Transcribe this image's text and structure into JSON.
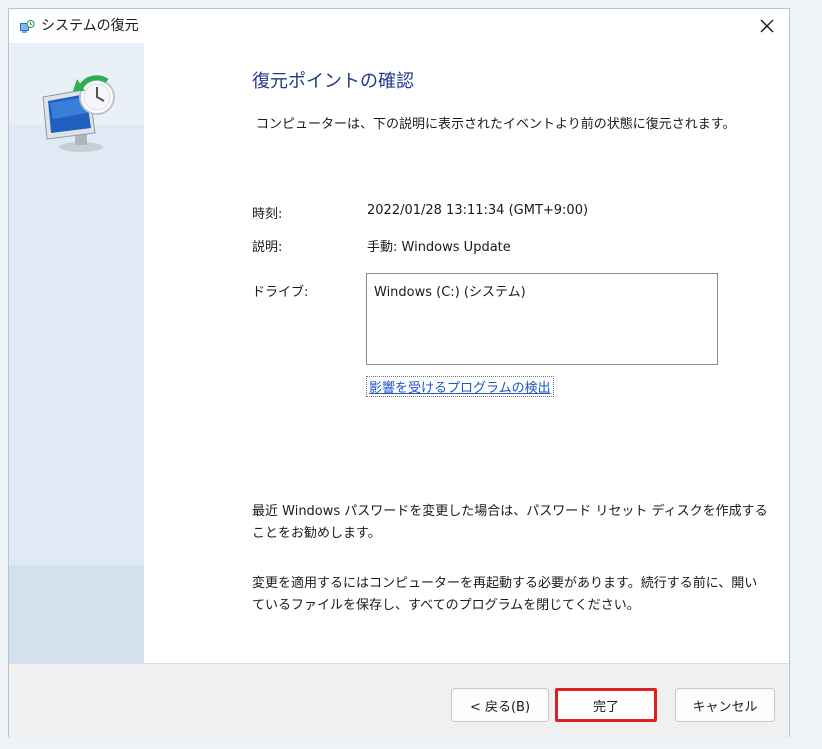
{
  "window": {
    "title": "システムの復元",
    "close_glyph": "✕"
  },
  "icons": {
    "title_icon": "system-restore-icon",
    "side_icon": "monitor-restore-clock-icon",
    "close": "close-icon"
  },
  "content": {
    "heading": "復元ポイントの確認",
    "intro": "コンピューターは、下の説明に表示されたイベントより前の状態に復元されます。",
    "time_label": "時刻:",
    "time_value": "2022/01/28 13:11:34 (GMT+9:00)",
    "description_label": "説明:",
    "description_value": "手動: Windows Update",
    "drive_label": "ドライブ:",
    "drives": [
      "Windows (C:) (システム)"
    ],
    "scan_link": "影響を受けるプログラムの検出",
    "note_password_line1": "最近 Windows パスワードを変更した場合は、パスワード リセット ディスクを作成する",
    "note_password_line2": "ことをお勧めします。",
    "note_restart_line1": "変更を適用するにはコンピューターを再起動する必要があります。続行する前に、開い",
    "note_restart_line2": "ているファイルを保存し、すべてのプログラムを閉じてください。"
  },
  "footer": {
    "back_label": "< 戻る(B)",
    "finish_label": "完了",
    "cancel_label": "キャンセル"
  },
  "colors": {
    "heading": "#1e3a8a",
    "link": "#1e55c8",
    "highlight": "#e02020",
    "side_panel": "#dfeaf5"
  }
}
